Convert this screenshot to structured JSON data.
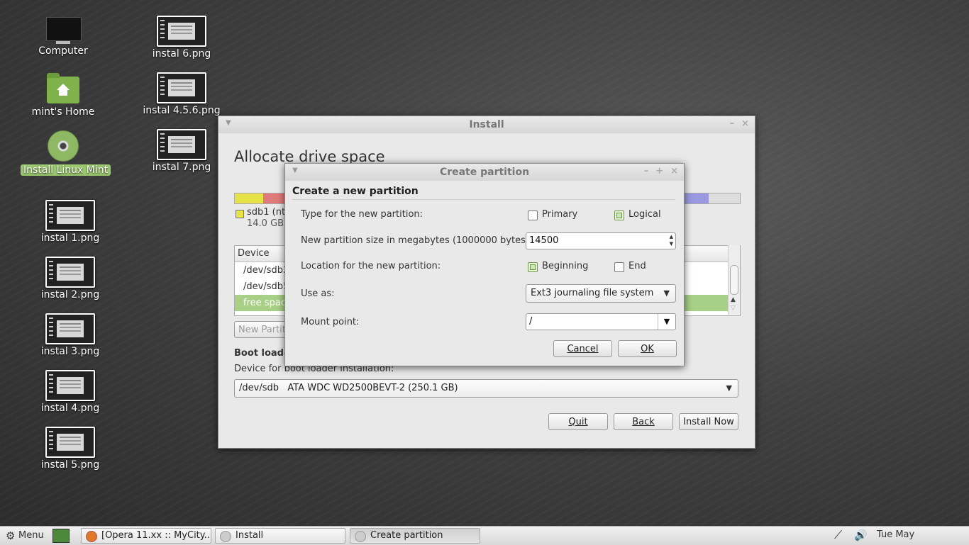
{
  "desktop": {
    "icons": [
      {
        "label": "Computer"
      },
      {
        "label": "mint's Home"
      },
      {
        "label": "Install Linux Mint"
      },
      {
        "label": "instal 1.png"
      },
      {
        "label": "instal 2.png"
      },
      {
        "label": "instal 3.png"
      },
      {
        "label": "instal 4.png"
      },
      {
        "label": "instal 5.png"
      },
      {
        "label": "instal 6.png"
      },
      {
        "label": "instal 4.5.6.png"
      },
      {
        "label": "instal 7.png"
      }
    ]
  },
  "install_window": {
    "title": "Install",
    "heading": "Allocate drive space",
    "legend": {
      "name": "sdb1 (nt",
      "size": "14.0 GB"
    },
    "table": {
      "header": "Device",
      "rows": [
        "/dev/sdb2",
        "/dev/sdb5",
        "free space"
      ]
    },
    "new_partition_button": "New Partiti",
    "boot_loader_heading": "Boot loade",
    "boot_device_label": "Device for boot loader installation:",
    "boot_device_value": "/dev/sdb   ATA WDC WD2500BEVT-2 (250.1 GB)",
    "buttons": {
      "quit": "Quit",
      "back": "Back",
      "install_now": "Install Now"
    }
  },
  "dialog": {
    "title": "Create partition",
    "heading": "Create a new partition",
    "type_label": "Type for the new partition:",
    "type_primary": "Primary",
    "type_logical": "Logical",
    "size_label": "New partition size in megabytes (1000000 bytes):",
    "size_value": "14500",
    "location_label": "Location for the new partition:",
    "location_beginning": "Beginning",
    "location_end": "End",
    "use_as_label": "Use as:",
    "use_as_value": "Ext3 journaling file system",
    "mount_label": "Mount point:",
    "mount_value": "/",
    "cancel": "Cancel",
    "ok": "OK"
  },
  "taskbar": {
    "menu": "Menu",
    "tasks": [
      "[Opera 11.xx :: MyCity...",
      "Install",
      "Create partition"
    ],
    "clock": "Tue May"
  },
  "colors": {
    "accent": "#9bc86f",
    "selection": "#a8cf86"
  }
}
